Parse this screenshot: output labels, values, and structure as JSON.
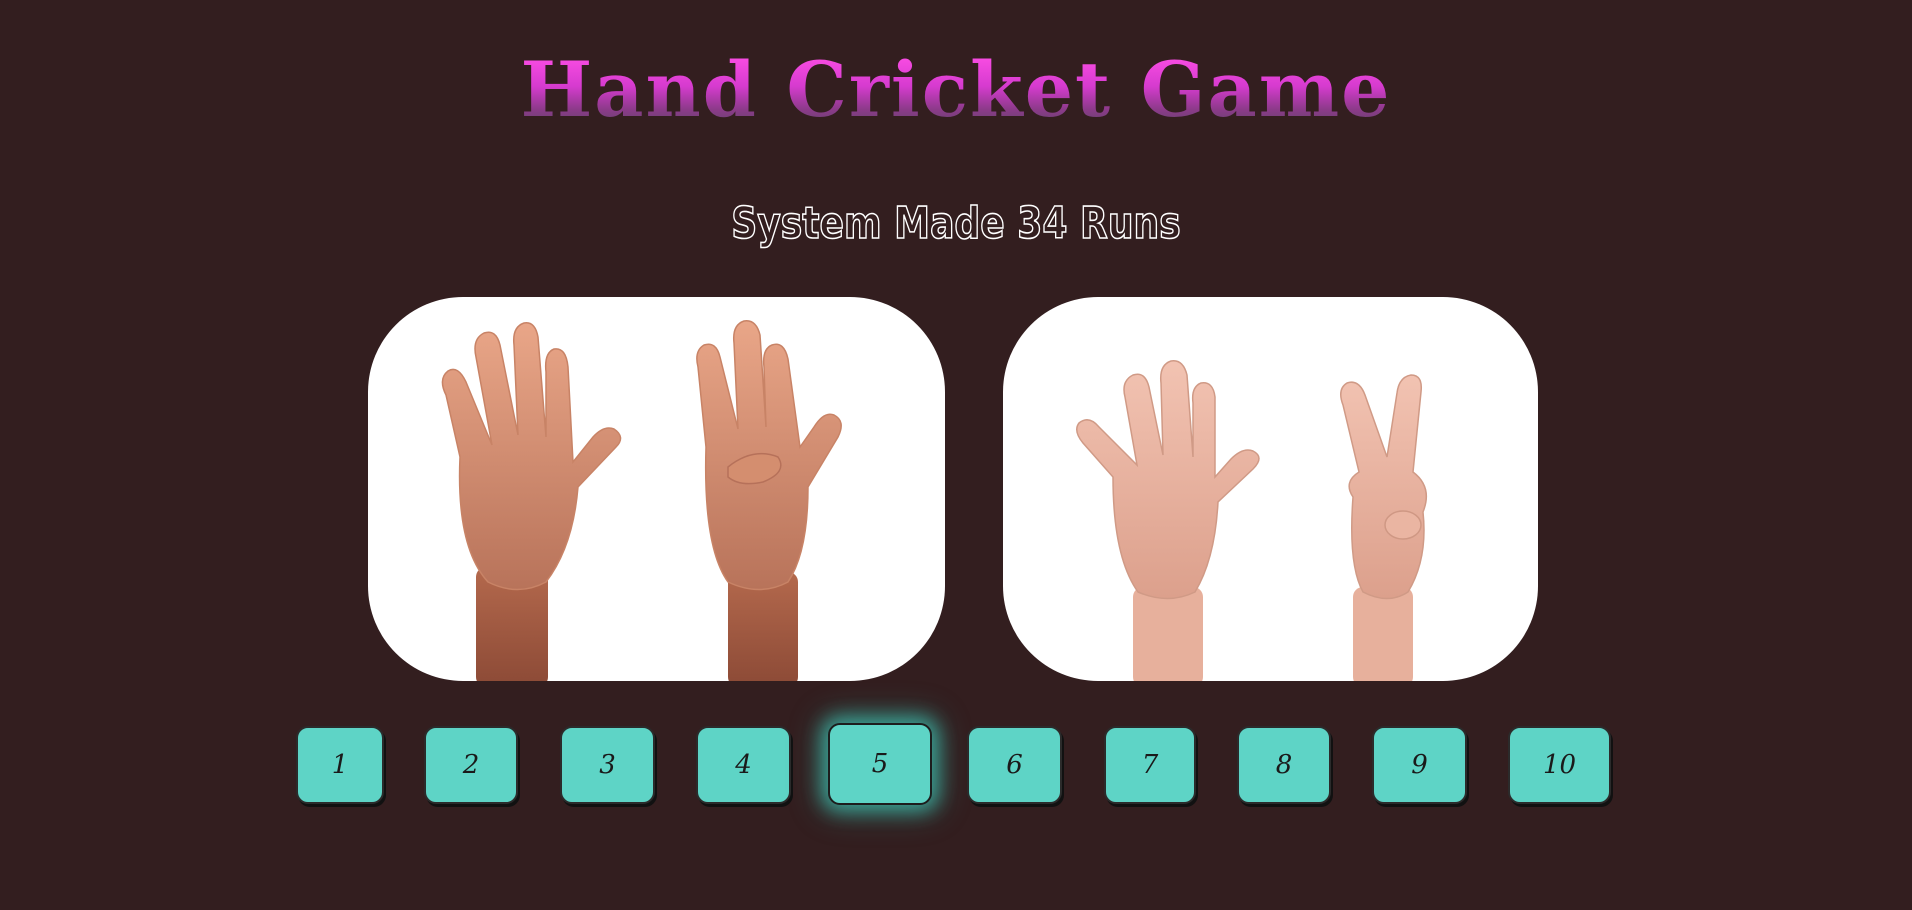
{
  "game": {
    "title": "Hand Cricket Game",
    "status": "System Made 34 Runs",
    "player_hand": {
      "fingers_shown": 9,
      "description": "five-and-four-fingers"
    },
    "system_hand": {
      "fingers_shown": 7,
      "description": "five-and-two-fingers"
    }
  },
  "buttons": [
    "1",
    "2",
    "3",
    "4",
    "5",
    "6",
    "7",
    "8",
    "9",
    "10"
  ],
  "selected_button": "5",
  "colors": {
    "background": "#331e1f",
    "button": "#5ed4c6",
    "title_gradient_top": "#ff4fe6",
    "title_gradient_bottom": "#5e4569"
  }
}
